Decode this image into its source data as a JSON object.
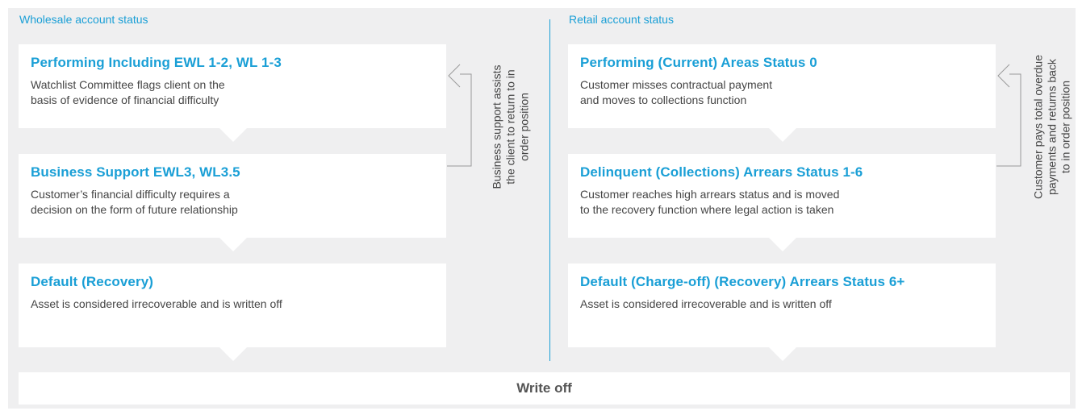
{
  "wholesale": {
    "title": "Wholesale account status",
    "cards": [
      {
        "title": "Performing Including EWL 1-2, WL 1-3",
        "desc": "Watchlist Committee flags client on the\nbasis of evidence of financial difficulty"
      },
      {
        "title": "Business Support EWL3, WL3.5",
        "desc": "Customer’s financial difficulty requires a\ndecision on the form of future relationship"
      },
      {
        "title": "Default (Recovery)",
        "desc": "Asset is considered irrecoverable and is written off"
      }
    ],
    "side_note": "Business support assists\nthe client to return to in\norder position"
  },
  "retail": {
    "title": "Retail account status",
    "cards": [
      {
        "title": "Performing (Current) Areas Status 0",
        "desc": "Customer misses contractual payment\nand moves to collections function"
      },
      {
        "title": "Delinquent (Collections) Arrears Status 1-6",
        "desc": "Customer reaches high arrears status and is moved\nto the recovery function where legal action is taken"
      },
      {
        "title": "Default (Charge-off) (Recovery) Arrears Status 6+",
        "desc": "Asset is considered irrecoverable and is written off"
      }
    ],
    "side_note": "Customer pays total overdue\npayments and returns back\nto in order position"
  },
  "write_off": "Write off",
  "colors": {
    "accent": "#1a9fd6",
    "panel": "#efeff0",
    "card": "#ffffff",
    "text": "#454545"
  }
}
